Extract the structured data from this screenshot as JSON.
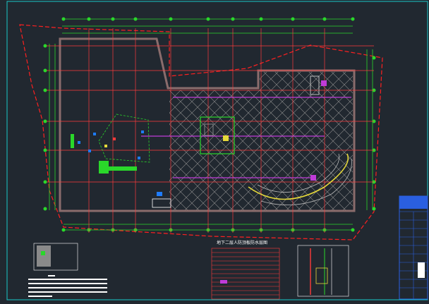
{
  "drawing": {
    "background": "#212830",
    "frame_color": "#19c7c8",
    "boundary_color": "#ff2020",
    "grid_color": "#ff3b3b",
    "dim_color": "#2ad82a",
    "wall_color": "#8a6c6c",
    "accent_purple": "#c03bd8",
    "ramp_color": "#e6d93a",
    "title_block_color": "#2a5fe0"
  },
  "legend": {
    "header_text": "地下二层人防顶板防水层图",
    "note_lines": 6
  },
  "title_block": {
    "rows": 18
  }
}
